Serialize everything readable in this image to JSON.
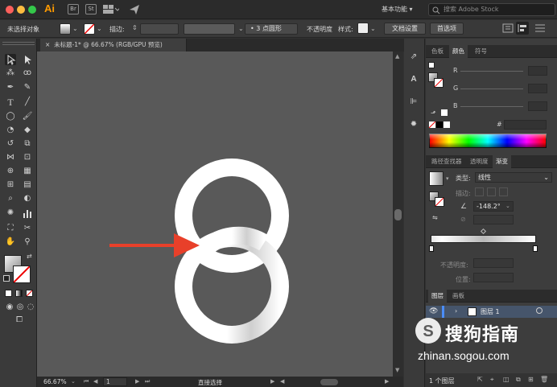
{
  "app": {
    "logo": "Ai",
    "workspace": "基本功能 ▾",
    "search_placeholder": "搜索 Adobe Stock"
  },
  "colors": {
    "close": "#fc605c",
    "minimize": "#fdbc40",
    "maximize": "#34c84a",
    "accent_arrow": "#e8402a",
    "logo": "#ff9a00"
  },
  "titlebar_icons": {
    "br": "Br",
    "st": "St"
  },
  "control_bar": {
    "selection_status": "未选择对象",
    "stroke_label": "描边:",
    "brush_profile": "3 点圆形",
    "opacity_label": "不透明度",
    "style_label": "样式:",
    "doc_setup": "文档设置",
    "preferences": "首选项"
  },
  "document": {
    "tab_close": "×",
    "tab_title": "未标题-1* @ 66.67% (RGB/GPU 预览)"
  },
  "status": {
    "zoom": "66.67%",
    "page": "1",
    "tool_name": "直接选择"
  },
  "color_panel": {
    "tabs": [
      "色板",
      "颜色",
      "符号"
    ],
    "active_tab": "颜色",
    "channels": [
      "R",
      "G",
      "B"
    ],
    "hex_symbol": "#"
  },
  "gradient_panel": {
    "tabs": [
      "路径查找器",
      "透明度",
      "渐变"
    ],
    "active_tab": "渐变",
    "type_label": "类型:",
    "type_value": "线性",
    "stroke_label": "描边:",
    "angle_value": "-148.2°",
    "opacity_label": "不透明度:",
    "location_label": "位置:"
  },
  "layers_panel": {
    "tabs": [
      "图层",
      "画板"
    ],
    "active_tab": "图层",
    "layer_name": "图层 1",
    "layer_count": "1 个图层"
  },
  "watermark": {
    "brand": "搜狗指南",
    "url": "zhinan.sogou.com"
  }
}
